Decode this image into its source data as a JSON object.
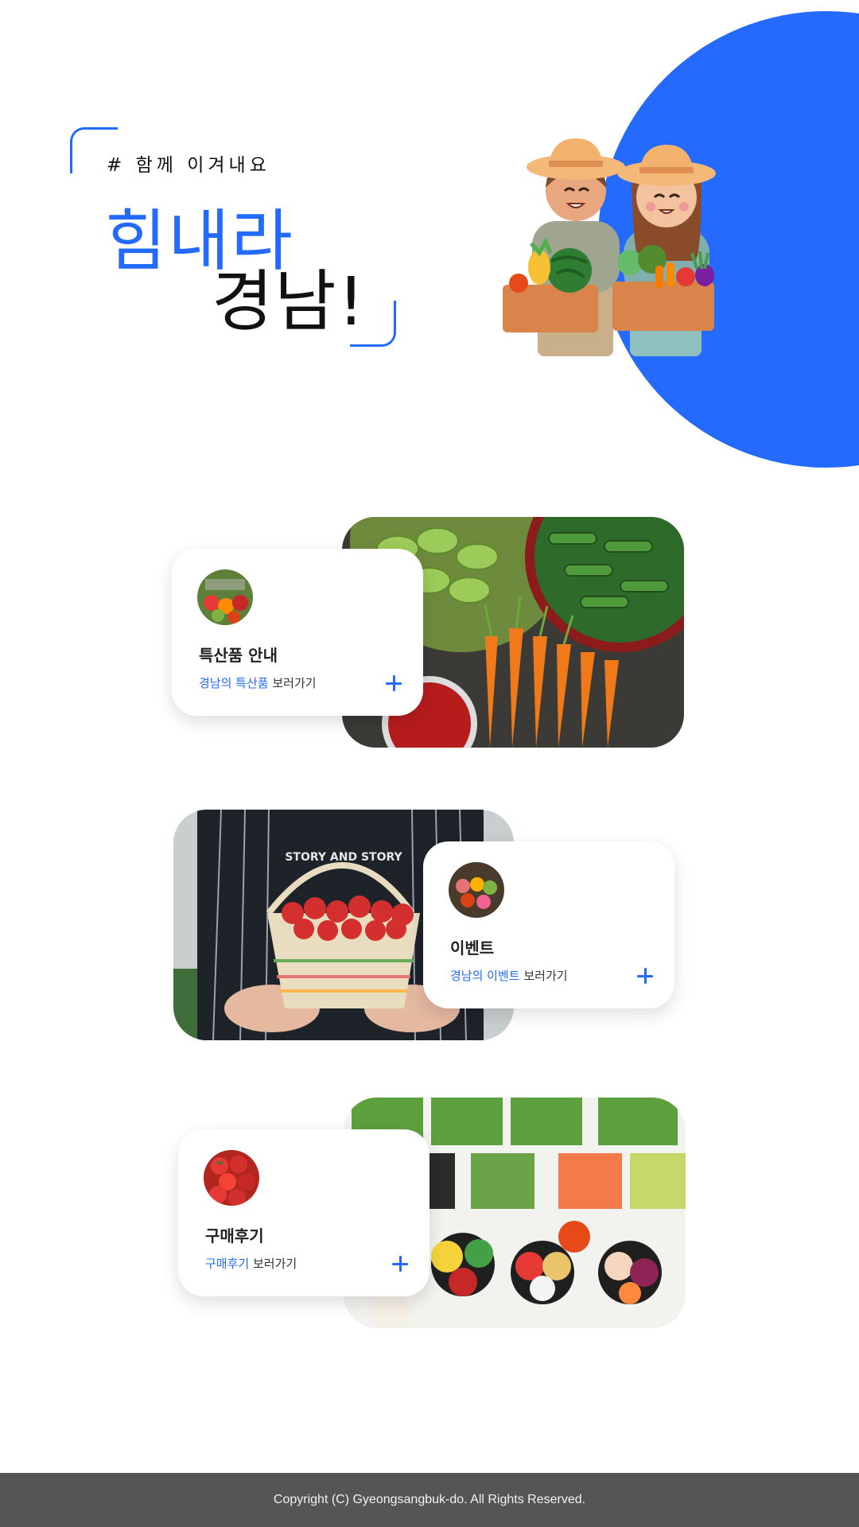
{
  "hero": {
    "tag": "# 함께 이겨내요",
    "headline_line1": "힘내라",
    "headline_line2": "경남!",
    "accent_color": "#246BFD",
    "illustration": "farmers-with-vegetable-baskets"
  },
  "cards": [
    {
      "title": "특산품 안내",
      "highlight": "경남의 특산품",
      "suffix": " 보러가기",
      "photo": "vegetables-market-photo",
      "thumb": "vegetables-thumbnail",
      "action_icon": "plus-icon"
    },
    {
      "title": "이벤트",
      "highlight": "경남의 이벤트",
      "suffix": " 보러가기",
      "photo": "strawberry-basket-photo",
      "thumb": "market-thumbnail",
      "action_icon": "plus-icon"
    },
    {
      "title": "구매후기",
      "highlight": "구매후기",
      "suffix": " 보러가기",
      "photo": "vegetable-platter-photo",
      "thumb": "tomatoes-thumbnail",
      "action_icon": "plus-icon"
    }
  ],
  "footer": {
    "copyright": "Copyright (C) Gyeongsangbuk-do. All Rights Reserved."
  }
}
